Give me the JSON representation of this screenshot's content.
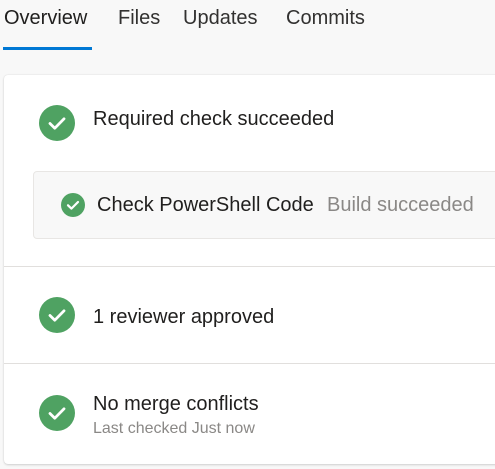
{
  "tabs": [
    {
      "label": "Overview",
      "active": true
    },
    {
      "label": "Files",
      "active": false
    },
    {
      "label": "Updates",
      "active": false
    },
    {
      "label": "Commits",
      "active": false
    }
  ],
  "checks": {
    "required": {
      "title": "Required check succeeded",
      "build": {
        "name": "Check PowerShell Code",
        "status": "Build succeeded"
      }
    },
    "reviewers": {
      "title": "1 reviewer approved"
    },
    "merge": {
      "title": "No merge conflicts",
      "subtitle": "Last checked Just now"
    }
  },
  "colors": {
    "accent": "#0078d4",
    "success": "#4fa262",
    "muted_text": "#8a8886"
  },
  "icons": {
    "success": "check-circle-icon"
  }
}
